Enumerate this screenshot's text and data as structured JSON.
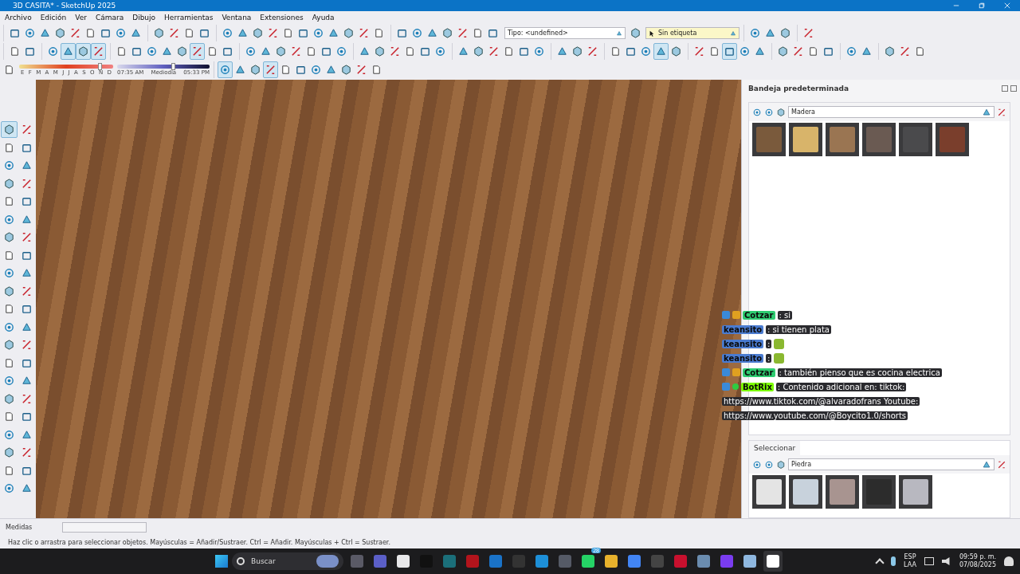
{
  "window": {
    "title": "3D CASITA* - SketchUp 2025"
  },
  "menu": [
    "Archivo",
    "Edición",
    "Ver",
    "Cámara",
    "Dibujo",
    "Herramientas",
    "Ventana",
    "Extensiones",
    "Ayuda"
  ],
  "toolbar_rows": [
    {
      "groups": [
        [
          {
            "selected": false
          },
          {
            "selected": false
          },
          {
            "selected": false
          },
          {
            "selected": false
          },
          {
            "selected": false
          },
          {
            "selected": false
          },
          {
            "selected": false
          },
          {
            "selected": false
          },
          {
            "selected": false
          }
        ],
        [
          {
            "selected": false
          },
          {
            "selected": false
          },
          {
            "selected": false
          },
          {
            "selected": false
          }
        ],
        [
          {
            "selected": false
          },
          {
            "selected": false
          },
          {
            "selected": false
          },
          {
            "selected": false
          },
          {
            "selected": false
          },
          {
            "selected": false
          },
          {
            "selected": false
          },
          {
            "selected": false
          },
          {
            "selected": false
          },
          {
            "selected": false
          },
          {
            "selected": false
          }
        ],
        [
          {
            "selected": false
          },
          {
            "selected": false
          },
          {
            "selected": false
          },
          {
            "selected": false
          },
          {
            "selected": false
          },
          {
            "selected": false
          },
          {
            "selected": false
          }
        ]
      ],
      "type_dropdown": "Tipo: <undefined>",
      "tag_dropdown": "Sin etiqueta",
      "tail": [
        [
          {
            "selected": false
          },
          {
            "selected": false
          },
          {
            "selected": false
          }
        ],
        [
          {
            "selected": false
          }
        ]
      ]
    },
    {
      "groups": [
        [
          {
            "selected": false
          },
          {
            "selected": false
          }
        ],
        [
          {
            "selected": false
          },
          {
            "selected": true
          },
          {
            "selected": true
          },
          {
            "selected": true
          }
        ],
        [
          {
            "selected": false
          },
          {
            "selected": false
          },
          {
            "selected": false
          },
          {
            "selected": false
          },
          {
            "selected": false
          },
          {
            "selected": true
          },
          {
            "selected": false
          },
          {
            "selected": false
          }
        ],
        [
          {
            "selected": false
          },
          {
            "selected": false
          },
          {
            "selected": false
          },
          {
            "selected": false
          },
          {
            "selected": false
          },
          {
            "selected": false
          },
          {
            "selected": false
          }
        ],
        [
          {
            "selected": false
          },
          {
            "selected": false
          },
          {
            "selected": false
          },
          {
            "selected": false
          },
          {
            "selected": false
          },
          {
            "selected": false
          }
        ],
        [
          {
            "selected": false
          },
          {
            "selected": false
          },
          {
            "selected": false
          },
          {
            "selected": false
          },
          {
            "selected": false
          },
          {
            "selected": false
          }
        ],
        [
          {
            "selected": false
          },
          {
            "selected": false
          },
          {
            "selected": false
          }
        ],
        [
          {
            "selected": false
          },
          {
            "selected": false
          },
          {
            "selected": false
          },
          {
            "selected": true
          },
          {
            "selected": false
          }
        ],
        [
          {
            "selected": false
          },
          {
            "selected": false
          },
          {
            "selected": true
          },
          {
            "selected": false
          },
          {
            "selected": false
          }
        ],
        [
          {
            "selected": false
          },
          {
            "selected": false
          },
          {
            "selected": false
          },
          {
            "selected": false
          }
        ],
        [
          {
            "selected": false
          },
          {
            "selected": false
          }
        ],
        [
          {
            "selected": false
          },
          {
            "selected": false
          },
          {
            "selected": false
          }
        ]
      ],
      "tail": []
    }
  ],
  "shadow": {
    "months": [
      "E",
      "F",
      "M",
      "A",
      "M",
      "J",
      "J",
      "A",
      "S",
      "O",
      "N",
      "D"
    ],
    "month_slider": {
      "level": 0.86
    },
    "time_start": "07:35 AM",
    "time_mid": "Mediodía",
    "time_end": "05:33 PM",
    "time_slider": {
      "level": 0.6
    }
  },
  "shadow_tools": [
    {
      "selected": true
    },
    {
      "selected": false
    },
    {
      "selected": false
    },
    {
      "selected": true
    },
    {
      "selected": false
    },
    {
      "selected": false
    },
    {
      "selected": false
    },
    {
      "selected": false
    },
    {
      "selected": false
    },
    {
      "selected": false
    },
    {
      "selected": false
    }
  ],
  "left_tools": [
    {
      "selected": true
    },
    {
      "selected": false
    },
    {
      "selected": false
    },
    {
      "selected": false
    },
    {
      "selected": false
    },
    {
      "selected": false
    },
    {
      "selected": false
    },
    {
      "selected": false
    },
    {
      "selected": false
    },
    {
      "selected": false
    },
    {
      "selected": false
    },
    {
      "selected": false
    },
    {
      "selected": false
    },
    {
      "selected": false
    },
    {
      "selected": false
    },
    {
      "selected": false
    },
    {
      "selected": false
    },
    {
      "selected": false
    },
    {
      "selected": false
    },
    {
      "selected": false
    },
    {
      "selected": false
    },
    {
      "selected": false
    },
    {
      "selected": false
    },
    {
      "selected": false
    },
    {
      "selected": false
    },
    {
      "selected": false
    },
    {
      "selected": false
    },
    {
      "selected": false
    },
    {
      "selected": false
    },
    {
      "selected": false
    },
    {
      "selected": false
    },
    {
      "selected": false
    },
    {
      "selected": false
    },
    {
      "selected": false
    },
    {
      "selected": false
    },
    {
      "selected": false
    },
    {
      "selected": false
    },
    {
      "selected": false
    },
    {
      "selected": false
    },
    {
      "selected": false
    },
    {
      "selected": false
    },
    {
      "selected": false
    }
  ],
  "chat": [
    {
      "kind": "message",
      "user": "Cotzar",
      "color": "#2ecc71",
      "badges": [
        {
          "kind": "moderator"
        },
        {
          "kind": "crown"
        }
      ],
      "text": ": si"
    },
    {
      "kind": "message",
      "user": "keansito",
      "color": "#4a7bd0",
      "text": ": si tienen plata"
    },
    {
      "kind": "emote",
      "user": "keansito",
      "color": "#4a7bd0",
      "text": ":"
    },
    {
      "kind": "emote",
      "user": "keansito",
      "color": "#4a7bd0",
      "text": ":"
    },
    {
      "kind": "message",
      "user": "Cotzar",
      "color": "#2ecc71",
      "badges": [
        {
          "kind": "moderator"
        },
        {
          "kind": "crown"
        }
      ],
      "text": ": también pienso que es cocina electrica"
    },
    {
      "kind": "message",
      "user": "BotRix",
      "color": "#7cfc00",
      "badges": [
        {
          "kind": "moderator"
        },
        {
          "kind": "verified"
        }
      ],
      "text": ": Contenido adicional en: tiktok:"
    },
    {
      "kind": "link",
      "text": "https://www.tiktok.com/@alvaradofrans Youtube:"
    },
    {
      "kind": "link",
      "text": "https://www.youtube.com/@Boycito1.0/shorts"
    }
  ],
  "tray": {
    "title": "Bandeja predeterminada",
    "sections": [
      {
        "collection": "Madera",
        "swatches": [
          {
            "color": "#7a5a3c"
          },
          {
            "color": "#d8b46a"
          },
          {
            "color": "#9a7552"
          },
          {
            "color": "#6a5a52"
          },
          {
            "color": "#4a4a4c"
          },
          {
            "color": "#7a3e2c"
          }
        ]
      },
      {
        "tab": "Seleccionar",
        "collection": "Piedra",
        "swatches": [
          {
            "color": "#e4e4e4"
          },
          {
            "color": "#c8d2dc"
          },
          {
            "color": "#a89490"
          },
          {
            "color": "#2c2c2c"
          },
          {
            "color": "#b8b8c0"
          }
        ]
      }
    ]
  },
  "measurements": {
    "label": "Medidas"
  },
  "status_bar": "Haz clic o arrastra para seleccionar objetos. Mayúsculas = Añadir/Sustraer. Ctrl = Añadir. Mayúsculas + Ctrl = Sustraer.",
  "taskbar": {
    "search": "Buscar",
    "apps": [
      {
        "color": "#5a5a66"
      },
      {
        "color": "#5b5fc7"
      },
      {
        "color": "#e8e8ea"
      },
      {
        "color": "#111111"
      },
      {
        "color": "#1b6f7a"
      },
      {
        "color": "#b3141c"
      },
      {
        "color": "#1a73c8"
      },
      {
        "color": "#333333"
      },
      {
        "color": "#1d8fd8"
      },
      {
        "color": "#555a66"
      },
      {
        "color": "#25d366"
      },
      {
        "color": "#e8b22c"
      },
      {
        "color": "#4285f4"
      },
      {
        "color": "#444444"
      },
      {
        "color": "#c8102e"
      },
      {
        "color": "#6a8caf"
      },
      {
        "color": "#7a3cf0"
      },
      {
        "color": "#8fb8e0"
      },
      {
        "color": "#ffffff"
      }
    ],
    "badge": "28",
    "lang": "ESP",
    "layout": "LAA",
    "time": "09:59 p. m.",
    "date": "07/08/2025"
  }
}
